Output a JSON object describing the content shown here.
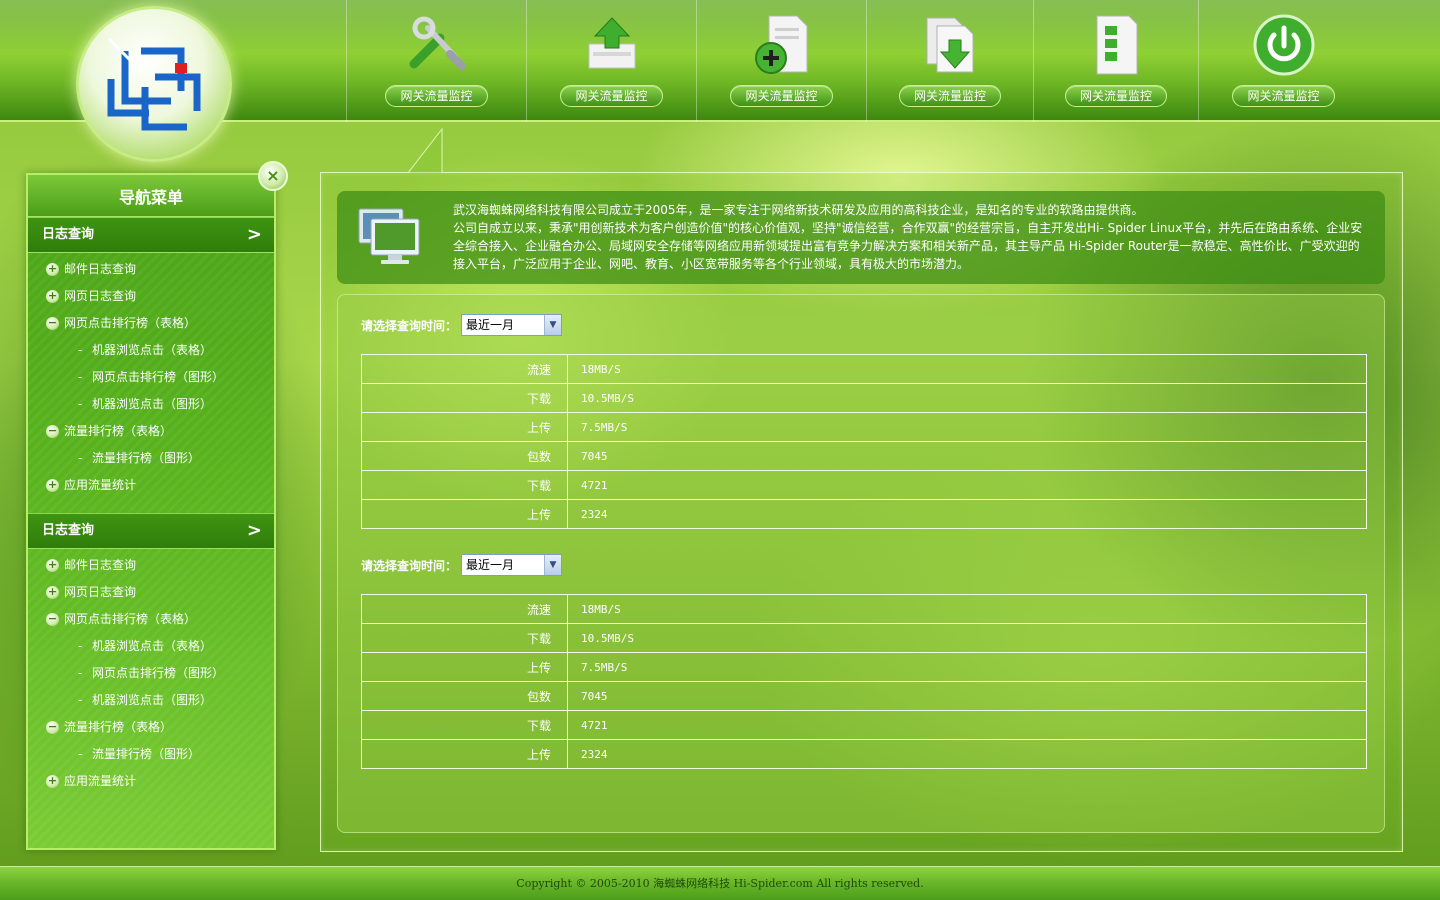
{
  "header": {
    "nav": [
      {
        "label": "网关流量监控",
        "icon": "tools-icon"
      },
      {
        "label": "网关流量监控",
        "icon": "upload-icon"
      },
      {
        "label": "网关流量监控",
        "icon": "add-document-icon"
      },
      {
        "label": "网关流量监控",
        "icon": "download-document-icon"
      },
      {
        "label": "网关流量监控",
        "icon": "list-document-icon"
      },
      {
        "label": "网关流量监控",
        "icon": "power-icon"
      }
    ]
  },
  "sidebar": {
    "title": "导航菜单",
    "close": "×",
    "sections": [
      {
        "title": "日志查询",
        "chevron": ">",
        "items": [
          {
            "label": "邮件日志查询",
            "bullet": "+"
          },
          {
            "label": "网页日志查询",
            "bullet": "+"
          },
          {
            "label": "网页点击排行榜（表格）",
            "bullet": "−"
          },
          {
            "label": "机器浏览点击（表格）",
            "dash": "-"
          },
          {
            "label": "网页点击排行榜（图形）",
            "dash": "-"
          },
          {
            "label": "机器浏览点击（图形）",
            "dash": "-"
          },
          {
            "label": "流量排行榜（表格）",
            "bullet": "−"
          },
          {
            "label": "流量排行榜（图形）",
            "dash": "-"
          },
          {
            "label": "应用流量统计",
            "bullet": "+"
          }
        ]
      },
      {
        "title": "日志查询",
        "chevron": ">",
        "items": [
          {
            "label": "邮件日志查询",
            "bullet": "+"
          },
          {
            "label": "网页日志查询",
            "bullet": "+"
          },
          {
            "label": "网页点击排行榜（表格）",
            "bullet": "−"
          },
          {
            "label": "机器浏览点击（表格）",
            "dash": "-"
          },
          {
            "label": "网页点击排行榜（图形）",
            "dash": "-"
          },
          {
            "label": "机器浏览点击（图形）",
            "dash": "-"
          },
          {
            "label": "流量排行榜（表格）",
            "bullet": "−"
          },
          {
            "label": "流量排行榜（图形）",
            "dash": "-"
          },
          {
            "label": "应用流量统计",
            "bullet": "+"
          }
        ]
      }
    ]
  },
  "info": {
    "paragraph1": "武汉海蜘蛛网络科技有限公司成立于2005年，是一家专注于网络新技术研发及应用的高科技企业，是知名的专业的软路由提供商。",
    "paragraph2": "公司自成立以来，秉承\"用创新技术为客户创造价值\"的核心价值观，坚持\"诚信经营，合作双赢\"的经营宗旨，自主开发出Hi- Spider Linux平台，并先后在路由系统、企业安全综合接入、企业融合办公、局域网安全存储等网络应用新领域提出富有竞争力解决方案和相关新产品，其主导产品 Hi-Spider Router是一款稳定、高性价比、广受欢迎的接入平台，广泛应用于企业、网吧、教育、小区宽带服务等各个行业领域，具有极大的市场潜力。"
  },
  "queries": [
    {
      "label": "请选择查询时间：",
      "select_value": "最近一月",
      "rows": [
        {
          "key": "流速",
          "value": "18MB/S"
        },
        {
          "key": "下载",
          "value": "10.5MB/S"
        },
        {
          "key": "上传",
          "value": "7.5MB/S"
        },
        {
          "key": "包数",
          "value": "7045"
        },
        {
          "key": "下载",
          "value": "4721"
        },
        {
          "key": "上传",
          "value": "2324"
        }
      ]
    },
    {
      "label": "请选择查询时间：",
      "select_value": "最近一月",
      "rows": [
        {
          "key": "流速",
          "value": "18MB/S"
        },
        {
          "key": "下载",
          "value": "10.5MB/S"
        },
        {
          "key": "上传",
          "value": "7.5MB/S"
        },
        {
          "key": "包数",
          "value": "7045"
        },
        {
          "key": "下载",
          "value": "4721"
        },
        {
          "key": "上传",
          "value": "2324"
        }
      ]
    }
  ],
  "footer": {
    "copyright": "Copyright © 2005-2010 海蜘蛛网络科技 Hi-Spider.com All rights reserved."
  },
  "colors": {
    "header_green": "#6cb524",
    "sidebar_green": "#4aa316",
    "accent_border": "#b7ee66"
  }
}
